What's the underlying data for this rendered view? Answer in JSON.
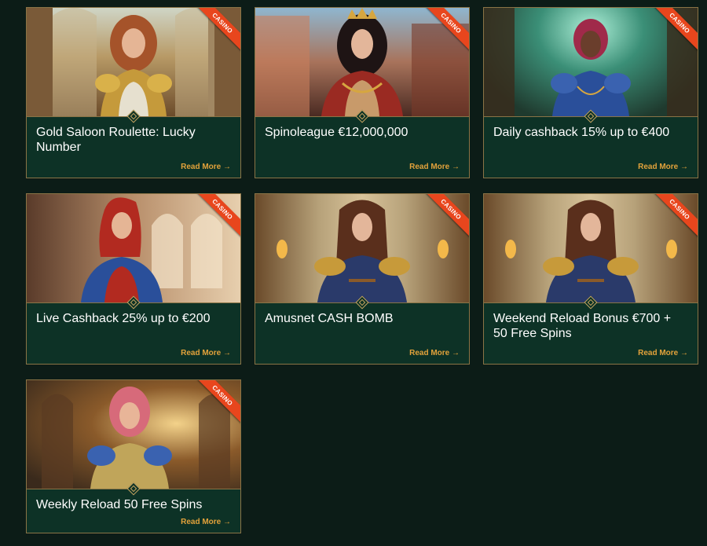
{
  "promotions": [
    {
      "title": "Gold Saloon Roulette: Lucky Number",
      "badge": "CASINO",
      "cta": "Read More →",
      "theme": "gold"
    },
    {
      "title": "Spinoleague €12,000,000",
      "badge": "CASINO",
      "cta": "Read More →",
      "theme": "queen"
    },
    {
      "title": "Daily cashback 15% up to €400",
      "badge": "CASINO",
      "cta": "Read More →",
      "theme": "teal"
    },
    {
      "title": "Live Cashback 25% up to €200",
      "badge": "CASINO",
      "cta": "Read More →",
      "theme": "red"
    },
    {
      "title": "Amusnet CASH BOMB",
      "badge": "CASINO",
      "cta": "Read More →",
      "theme": "street"
    },
    {
      "title": "Weekend Reload Bonus €700 + 50 Free Spins",
      "badge": "CASINO",
      "cta": "Read More →",
      "theme": "street"
    },
    {
      "title": "Weekly Reload 50 Free Spins",
      "badge": "CASINO",
      "cta": "Read More →",
      "theme": "hall"
    }
  ],
  "colors": {
    "page_bg": "#0c1c17",
    "card_bg": "#0d3226",
    "border": "#8a7446",
    "badge": "#e8461d",
    "cta": "#e2a23b"
  }
}
